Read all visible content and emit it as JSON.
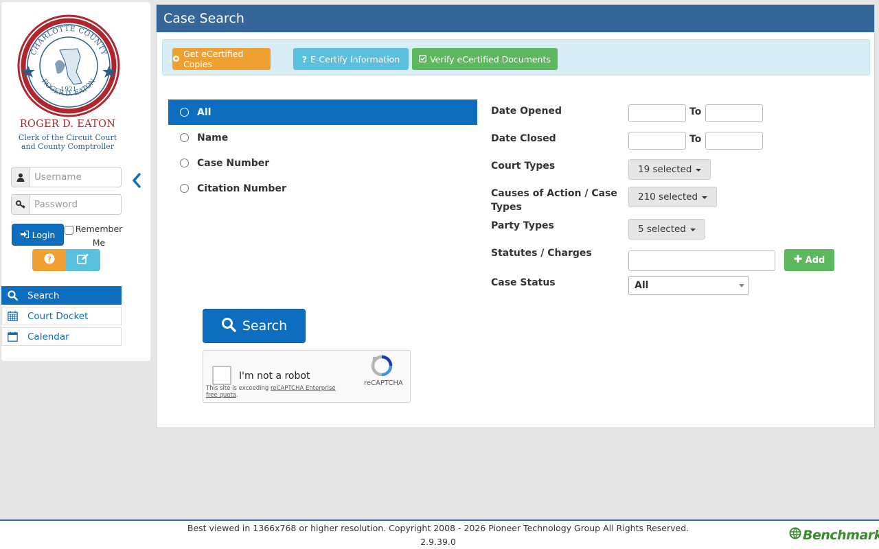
{
  "sidebar": {
    "seal_text": "CLERK & COMPTROLLER CHARLOTTE COUNTY FLORIDA 1921 ROGER D. EATON",
    "clerk_name": "ROGER D. EATON",
    "clerk_title_line1": "Clerk of the Circuit Court",
    "clerk_title_line2": "and County Comptroller",
    "username_placeholder": "Username",
    "password_placeholder": "Password",
    "login_label": "Login",
    "remember_label": "Remember Me",
    "nav": [
      {
        "label": "Search",
        "icon": "search-icon",
        "active": true
      },
      {
        "label": "Court Docket",
        "icon": "calendar-grid-icon",
        "active": false
      },
      {
        "label": "Calendar",
        "icon": "calendar-icon",
        "active": false
      }
    ]
  },
  "main": {
    "title": "Case Search",
    "ecert_buttons": {
      "get_copies": "Get eCertified Copies",
      "info": "E-Certify Information",
      "verify": "Verify eCertified Documents"
    },
    "search_types": [
      {
        "label": "All",
        "selected": true
      },
      {
        "label": "Name",
        "selected": false
      },
      {
        "label": "Case Number",
        "selected": false
      },
      {
        "label": "Citation Number",
        "selected": false
      }
    ],
    "filters": {
      "date_opened_label": "Date Opened",
      "date_closed_label": "Date Closed",
      "to_label": "To",
      "court_types_label": "Court Types",
      "court_types_value": "19 selected",
      "causes_label": "Causes of Action / Case Types",
      "causes_value": "210 selected",
      "party_types_label": "Party Types",
      "party_types_value": "5 selected",
      "statutes_label": "Statutes / Charges",
      "add_label": "Add",
      "case_status_label": "Case Status",
      "case_status_value": "All"
    },
    "search_button": "Search",
    "recaptcha": {
      "label": "I'm not a robot",
      "warning_prefix": "This site is exceeding ",
      "warning_link": "reCAPTCHA Enterprise free quota",
      "warning_suffix": ".",
      "brand": "reCAPTCHA"
    }
  },
  "footer": {
    "text": "Best viewed in 1366x768 or higher resolution. Copyright 2008 - 2026 Pioneer Technology Group All Rights Reserved.",
    "version": "2.9.39.0",
    "logo": "Benchmark"
  },
  "colors": {
    "primary": "#0d6ec0",
    "header": "#35669a",
    "warning": "#f0a030",
    "info": "#5bc0de",
    "success": "#5cb85c",
    "clerk_red": "#b0262e"
  }
}
